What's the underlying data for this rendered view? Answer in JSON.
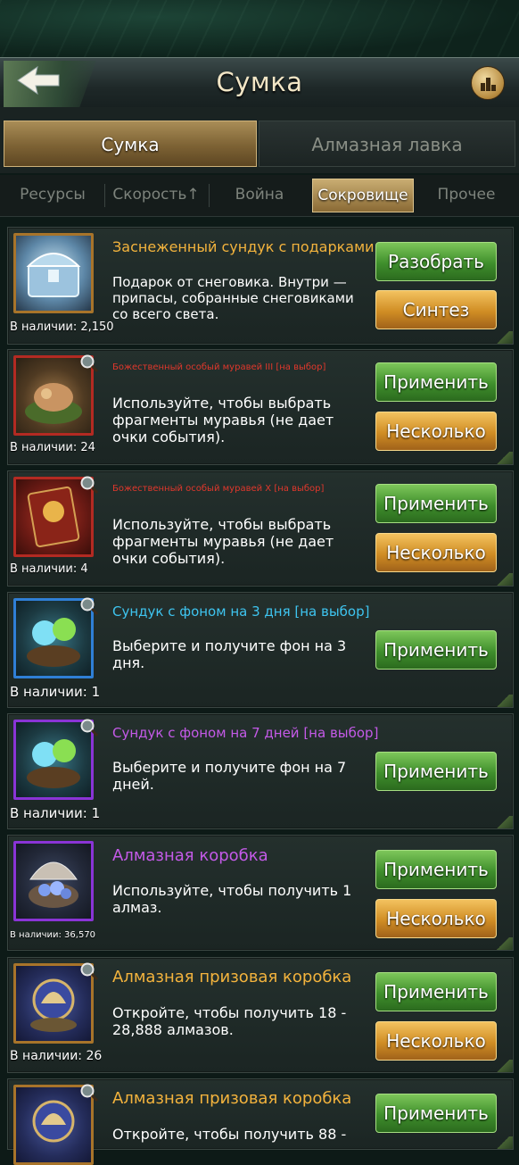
{
  "header": {
    "title": "Сумка"
  },
  "main_tabs": [
    "Сумка",
    "Алмазная лавка"
  ],
  "sub_tabs": [
    "Ресурсы",
    "Скорость↑",
    "Война",
    "Сокровище",
    "Прочее"
  ],
  "items": [
    {
      "name": "Заснеженный сундук с подарками",
      "description": "Подарок от снеговика. Внутри — припасы, собранные снеговиками со всего света.",
      "available": "В наличии: 2,150",
      "buttons": [
        "Разобрать",
        "Синтез"
      ]
    },
    {
      "name": "Божественный особый муравей III [на выбор]",
      "description": "Используйте, чтобы выбрать фрагменты муравья (не дает очки события).",
      "available": "В наличии: 24",
      "buttons": [
        "Применить",
        "Несколько"
      ]
    },
    {
      "name": "Божественный особый муравей X [на выбор]",
      "description": "Используйте, чтобы выбрать фрагменты муравья (не дает очки события).",
      "available": "В наличии: 4",
      "buttons": [
        "Применить",
        "Несколько"
      ]
    },
    {
      "name": "Сундук с фоном на 3 дня [на выбор]",
      "description": "Выберите и получите фон на 3 дня.",
      "available": "В наличии: 1",
      "buttons": [
        "Применить"
      ]
    },
    {
      "name": "Сундук с фоном на 7 дней [на выбор]",
      "description": "Выберите и получите фон на 7 дней.",
      "available": "В наличии: 1",
      "buttons": [
        "Применить"
      ]
    },
    {
      "name": "Алмазная коробка",
      "description": "Используйте, чтобы получить 1 алмаз.",
      "available": "В наличии: 36,570",
      "buttons": [
        "Применить",
        "Несколько"
      ]
    },
    {
      "name": "Алмазная призовая коробка",
      "description": "Откройте, чтобы получить 18 - 28,888 алмазов.",
      "available": "В наличии: 26",
      "buttons": [
        "Применить",
        "Несколько"
      ]
    },
    {
      "name": "Алмазная призовая коробка",
      "description": "Откройте, чтобы получить 88 -",
      "buttons": [
        "Применить"
      ]
    }
  ],
  "colors": {
    "name_orange": "#f3b33d",
    "name_red": "#e0382c",
    "name_blue": "#3ec4ef",
    "name_purple": "#c45ae8",
    "green_button": "#4a9a33",
    "orange_button": "#d08d24"
  }
}
